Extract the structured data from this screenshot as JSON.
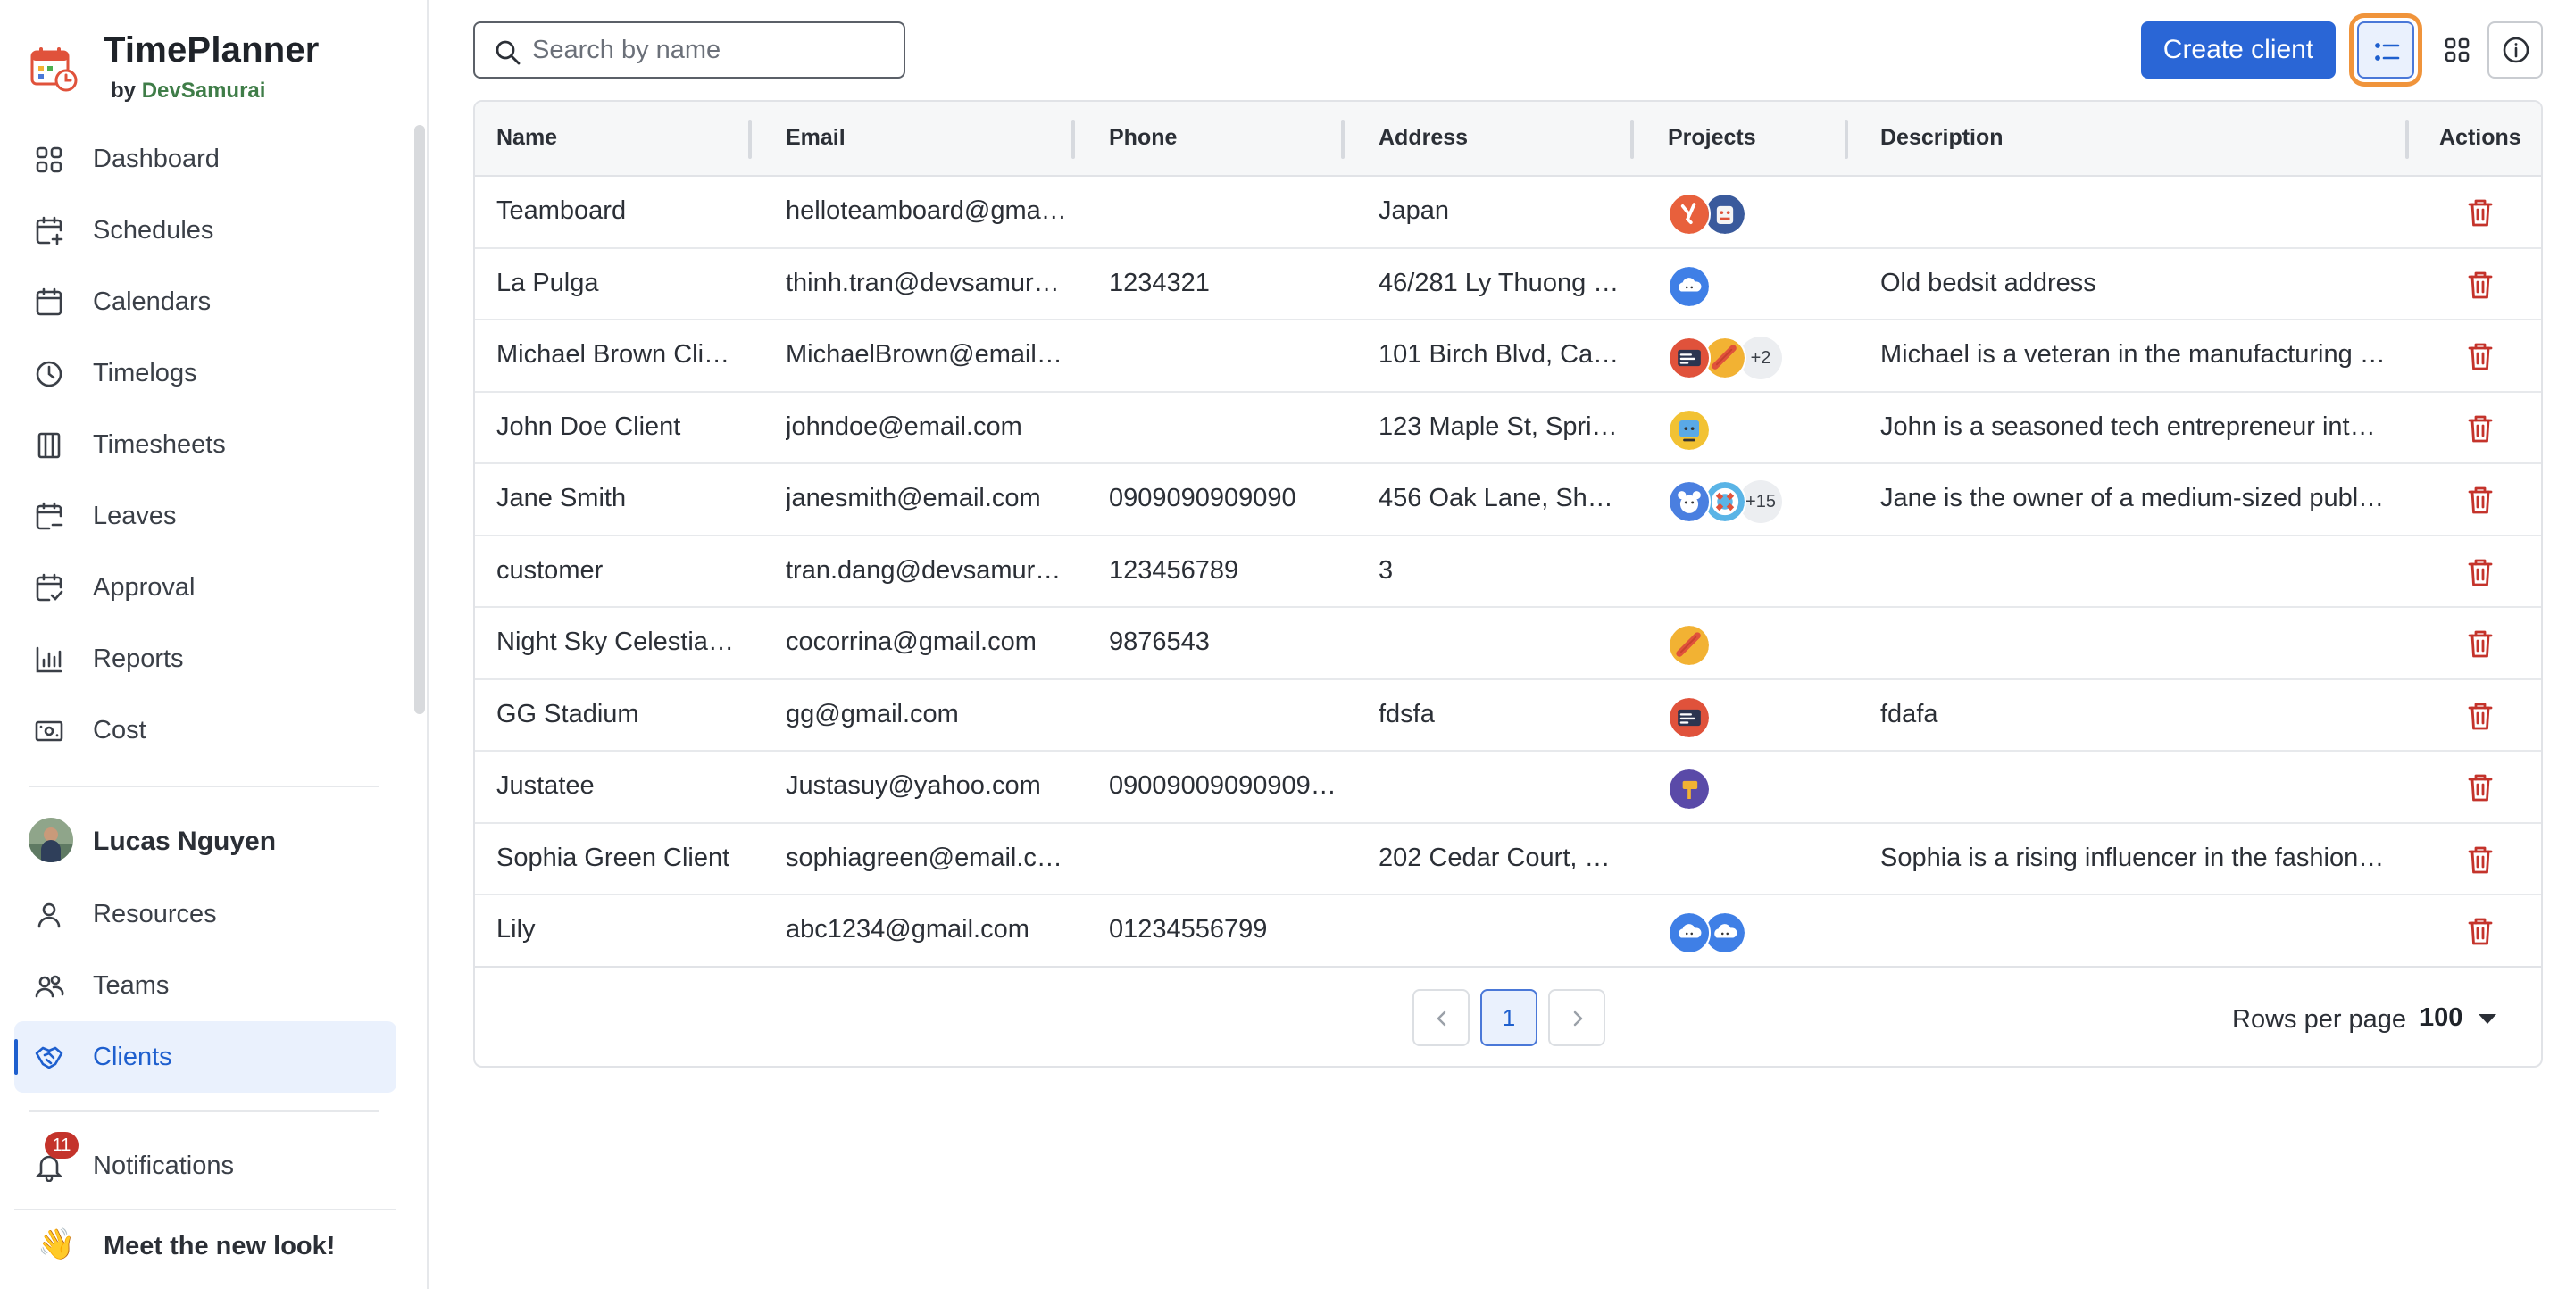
{
  "brand": {
    "title": "TimePlanner",
    "by": "by",
    "company": "DevSamurai"
  },
  "nav": {
    "items": [
      {
        "label": "Dashboard",
        "icon": "dashboard-icon"
      },
      {
        "label": "Schedules",
        "icon": "calendar-plus-icon"
      },
      {
        "label": "Calendars",
        "icon": "calendar-icon"
      },
      {
        "label": "Timelogs",
        "icon": "clock-icon"
      },
      {
        "label": "Timesheets",
        "icon": "columns-icon"
      },
      {
        "label": "Leaves",
        "icon": "calendar-minus-icon"
      },
      {
        "label": "Approval",
        "icon": "calendar-check-icon"
      },
      {
        "label": "Reports",
        "icon": "bar-chart-icon"
      },
      {
        "label": "Cost",
        "icon": "money-icon"
      }
    ],
    "user_name": "Lucas Nguyen",
    "user_items": [
      {
        "label": "Resources",
        "icon": "person-icon"
      },
      {
        "label": "Teams",
        "icon": "people-icon"
      },
      {
        "label": "Clients",
        "icon": "handshake-icon"
      }
    ],
    "notifications": {
      "label": "Notifications",
      "count": "11"
    },
    "new_look": "Meet the new look!"
  },
  "toolbar": {
    "search_placeholder": "Search by name",
    "search_value": "",
    "create_label": "Create client"
  },
  "table": {
    "headers": {
      "name": "Name",
      "email": "Email",
      "phone": "Phone",
      "address": "Address",
      "projects": "Projects",
      "description": "Description",
      "actions": "Actions"
    },
    "rows": [
      {
        "name": "Teamboard",
        "email": "helloteamboard@gma…",
        "phone": "",
        "address": "Japan",
        "projects": [
          "tools",
          "robot"
        ],
        "more": "",
        "description": ""
      },
      {
        "name": "La Pulga",
        "email": "thinh.tran@devsamur…",
        "phone": "1234321",
        "address": "46/281 Ly Thuong …",
        "projects": [
          "cloud"
        ],
        "more": "",
        "description": "Old bedsit address"
      },
      {
        "name": "Michael Brown Cli…",
        "email": "MichaelBrown@email…",
        "phone": "",
        "address": "101 Birch Blvd, Ca…",
        "projects": [
          "terminal",
          "hotdog"
        ],
        "more": "+2",
        "description": "Michael is a veteran in the manufacturing i…"
      },
      {
        "name": "John Doe Client",
        "email": "johndoe@email.com",
        "phone": "",
        "address": "123 Maple St, Spri…",
        "projects": [
          "painting"
        ],
        "more": "",
        "description": "John is a seasoned tech entrepreneur inte…"
      },
      {
        "name": "Jane Smith",
        "email": "janesmith@email.com",
        "phone": "0909090909090",
        "address": "456 Oak Lane, Sh…",
        "projects": [
          "bear",
          "lifebuoy"
        ],
        "more": "+15",
        "description": "Jane is the owner of a medium-sized publi…"
      },
      {
        "name": "customer",
        "email": "tran.dang@devsamur…",
        "phone": "123456789",
        "address": "3",
        "projects": [],
        "more": "",
        "description": ""
      },
      {
        "name": "Night Sky Celestial…",
        "email": "cocorrina@gmail.com",
        "phone": "9876543",
        "address": "",
        "projects": [
          "hotdog"
        ],
        "more": "",
        "description": ""
      },
      {
        "name": "GG Stadium",
        "email": "gg@gmail.com",
        "phone": "",
        "address": "fdsfa",
        "projects": [
          "terminal"
        ],
        "more": "",
        "description": "fdafa"
      },
      {
        "name": "Justatee",
        "email": "Justasuy@yahoo.com",
        "phone": "09009009090909…",
        "address": "",
        "projects": [
          "sign"
        ],
        "more": "",
        "description": ""
      },
      {
        "name": "Sophia Green Client",
        "email": "sophiagreen@email.c…",
        "phone": "",
        "address": "202 Cedar Court, …",
        "projects": [],
        "more": "",
        "description": "Sophia is a rising influencer in the fashion …"
      },
      {
        "name": "Lily",
        "email": "abc1234@gmail.com",
        "phone": "01234556799",
        "address": "",
        "projects": [
          "cloud",
          "cloud"
        ],
        "more": "",
        "description": ""
      }
    ]
  },
  "pagination": {
    "current": "1",
    "rows_per_page_label": "Rows per page",
    "rows_per_page": "100"
  },
  "colors": {
    "accent": "#2a66d6",
    "delete": "#c4332b",
    "highlight": "#f0943b"
  }
}
